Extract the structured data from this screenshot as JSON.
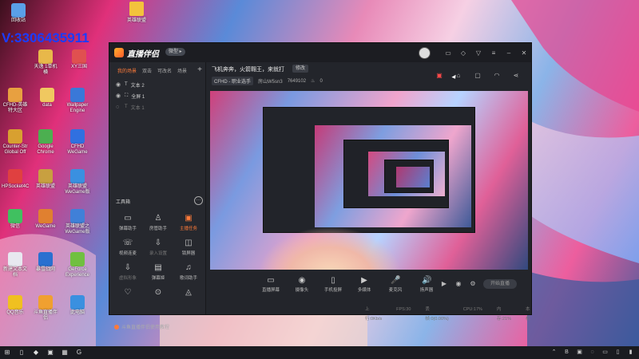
{
  "colors": {
    "accent": "#ff7b3a",
    "watermark": "#1a3cff",
    "window_bg": "#23252b"
  },
  "desktop": {
    "watermark": "V:3306435911",
    "top_icon": "英雄联盟",
    "icons": [
      {
        "label": "回收站",
        "color": "#5aa0e8"
      },
      {
        "label": "天逸 1单机横",
        "color": "#e8b84a"
      },
      {
        "label": "XY三国",
        "color": "#e05050"
      },
      {
        "label": "CFHD-英雄 特大区",
        "color": "#e8a040"
      },
      {
        "label": "data",
        "color": "#f0c860"
      },
      {
        "label": "Wallpaper Engine",
        "color": "#3a78d8"
      },
      {
        "label": "Counter-Str Global Off",
        "color": "#d8a030"
      },
      {
        "label": "Google Chrome",
        "color": "#4caf50"
      },
      {
        "label": "CFHD WeGame",
        "color": "#3070e0"
      },
      {
        "label": "HPSocket4C",
        "color": "#e04040"
      },
      {
        "label": "英雄联盟",
        "color": "#c8a040"
      },
      {
        "label": "英雄联盟 WeGame版",
        "color": "#3a90e0"
      },
      {
        "label": "微信",
        "color": "#40c060"
      },
      {
        "label": "WeGame",
        "color": "#e08030"
      },
      {
        "label": "英雄联盟之 WeGame版",
        "color": "#4080d8"
      },
      {
        "label": "新建文本文档",
        "color": "#e8e8f0"
      },
      {
        "label": "暴雪战网",
        "color": "#2a70d0"
      },
      {
        "label": "GeForce Experience",
        "color": "#70c040"
      },
      {
        "label": "QQ音乐",
        "color": "#f0c020"
      },
      {
        "label": "斗鱼直播伴侣",
        "color": "#f0a030"
      },
      {
        "label": "此电脑",
        "color": "#3a90e0"
      }
    ]
  },
  "window": {
    "app_title": "直播伴侣",
    "version_badge": "微型 ▸",
    "scene_tabs": [
      "我的场景",
      "双击",
      "可改名",
      "场景"
    ],
    "add_scene": "+",
    "sources": [
      {
        "label": "文本 2",
        "dim": false
      },
      {
        "label": "全屏 1",
        "dim": false
      },
      {
        "label": "文本 1",
        "dim": true
      }
    ],
    "tools_heading": "工具箱",
    "more": "···",
    "tools": [
      {
        "label": "弹幕助手",
        "icon": "▭"
      },
      {
        "label": "房管助手",
        "icon": "♙"
      },
      {
        "label": "主播任务",
        "icon": "▣",
        "hot": true
      },
      {
        "label": "视频连麦",
        "icon": "☏"
      },
      {
        "label": "录入设置",
        "icon": "⇩",
        "dim": true
      },
      {
        "label": "锁屏器",
        "icon": "◫"
      },
      {
        "label": "虚拟形象",
        "icon": "⇩",
        "dim": true
      },
      {
        "label": "弹幕姬",
        "icon": "▤"
      },
      {
        "label": "歌词助手",
        "icon": "♫"
      },
      {
        "label": "",
        "icon": "♡"
      },
      {
        "label": "",
        "icon": "⊙"
      },
      {
        "label": "",
        "icon": "◬"
      }
    ],
    "help_link": "斗鱼直播伴侣使用教程",
    "room_title": "飞机奔奔，火箭翱王，来就打",
    "edit_label": "修改",
    "category": "CFHD - 职业选手",
    "room_id": "房山W5sn3",
    "room_number": "7649102",
    "likes": "0",
    "bottom_tools": [
      {
        "label": "直播屏幕",
        "icon": "▭"
      },
      {
        "label": "摄像头",
        "icon": "◉"
      },
      {
        "label": "手机投屏",
        "icon": "▯"
      },
      {
        "label": "多媒体",
        "icon": "▶"
      },
      {
        "label": "麦克风",
        "icon": "🎤"
      },
      {
        "label": "扬声器",
        "icon": "🔊"
      }
    ],
    "live_button": "开始直播",
    "status": [
      "上行:0Kb/s",
      "FPS:30",
      "丢帧:0(0.00%)",
      "CPU:17%",
      "内存:21%",
      "本机"
    ]
  },
  "taskbar": {
    "icons": [
      "⊞",
      "▯",
      "◆",
      "▣",
      "▦",
      "G"
    ],
    "tray": [
      "⌃",
      "B",
      "▣",
      "◌",
      "▭",
      "▯",
      "▮"
    ]
  }
}
